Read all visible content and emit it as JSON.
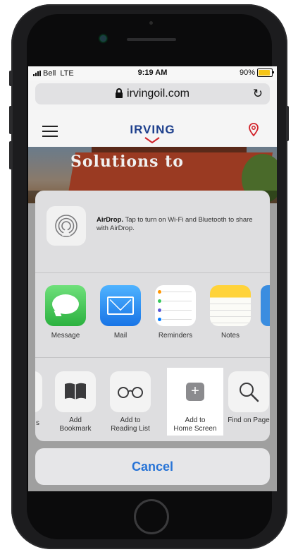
{
  "status_bar": {
    "carrier": "Bell",
    "network": "LTE",
    "time": "9:19 AM",
    "battery": "90%",
    "battery_fraction": 0.9
  },
  "browser": {
    "url": "irvingoil.com",
    "reload_icon": "reload-icon",
    "lock_icon": "lock-icon"
  },
  "site": {
    "logo": "IRVING",
    "hero_text": "Solutions to"
  },
  "share_sheet": {
    "airdrop": {
      "title": "AirDrop.",
      "message": "Tap to turn on Wi-Fi and Bluetooth to share with AirDrop."
    },
    "apps": [
      {
        "label": "Message",
        "icon": "message-icon"
      },
      {
        "label": "Mail",
        "icon": "mail-icon"
      },
      {
        "label": "Reminders",
        "icon": "reminders-icon"
      },
      {
        "label": "Notes",
        "icon": "notes-icon"
      }
    ],
    "actions": [
      {
        "label": "s",
        "icon": "partial-action-icon"
      },
      {
        "label": "Add\nBookmark",
        "icon": "bookmark-icon"
      },
      {
        "label": "Add to\nReading List",
        "icon": "reading-glasses-icon"
      },
      {
        "label": "Add to\nHome Screen",
        "icon": "add-icon"
      },
      {
        "label": "Find on Page",
        "icon": "search-icon"
      }
    ],
    "cancel": "Cancel"
  },
  "colors": {
    "accent": "#2874d6",
    "battery": "#f5c518",
    "highlight": "#ffffff"
  }
}
